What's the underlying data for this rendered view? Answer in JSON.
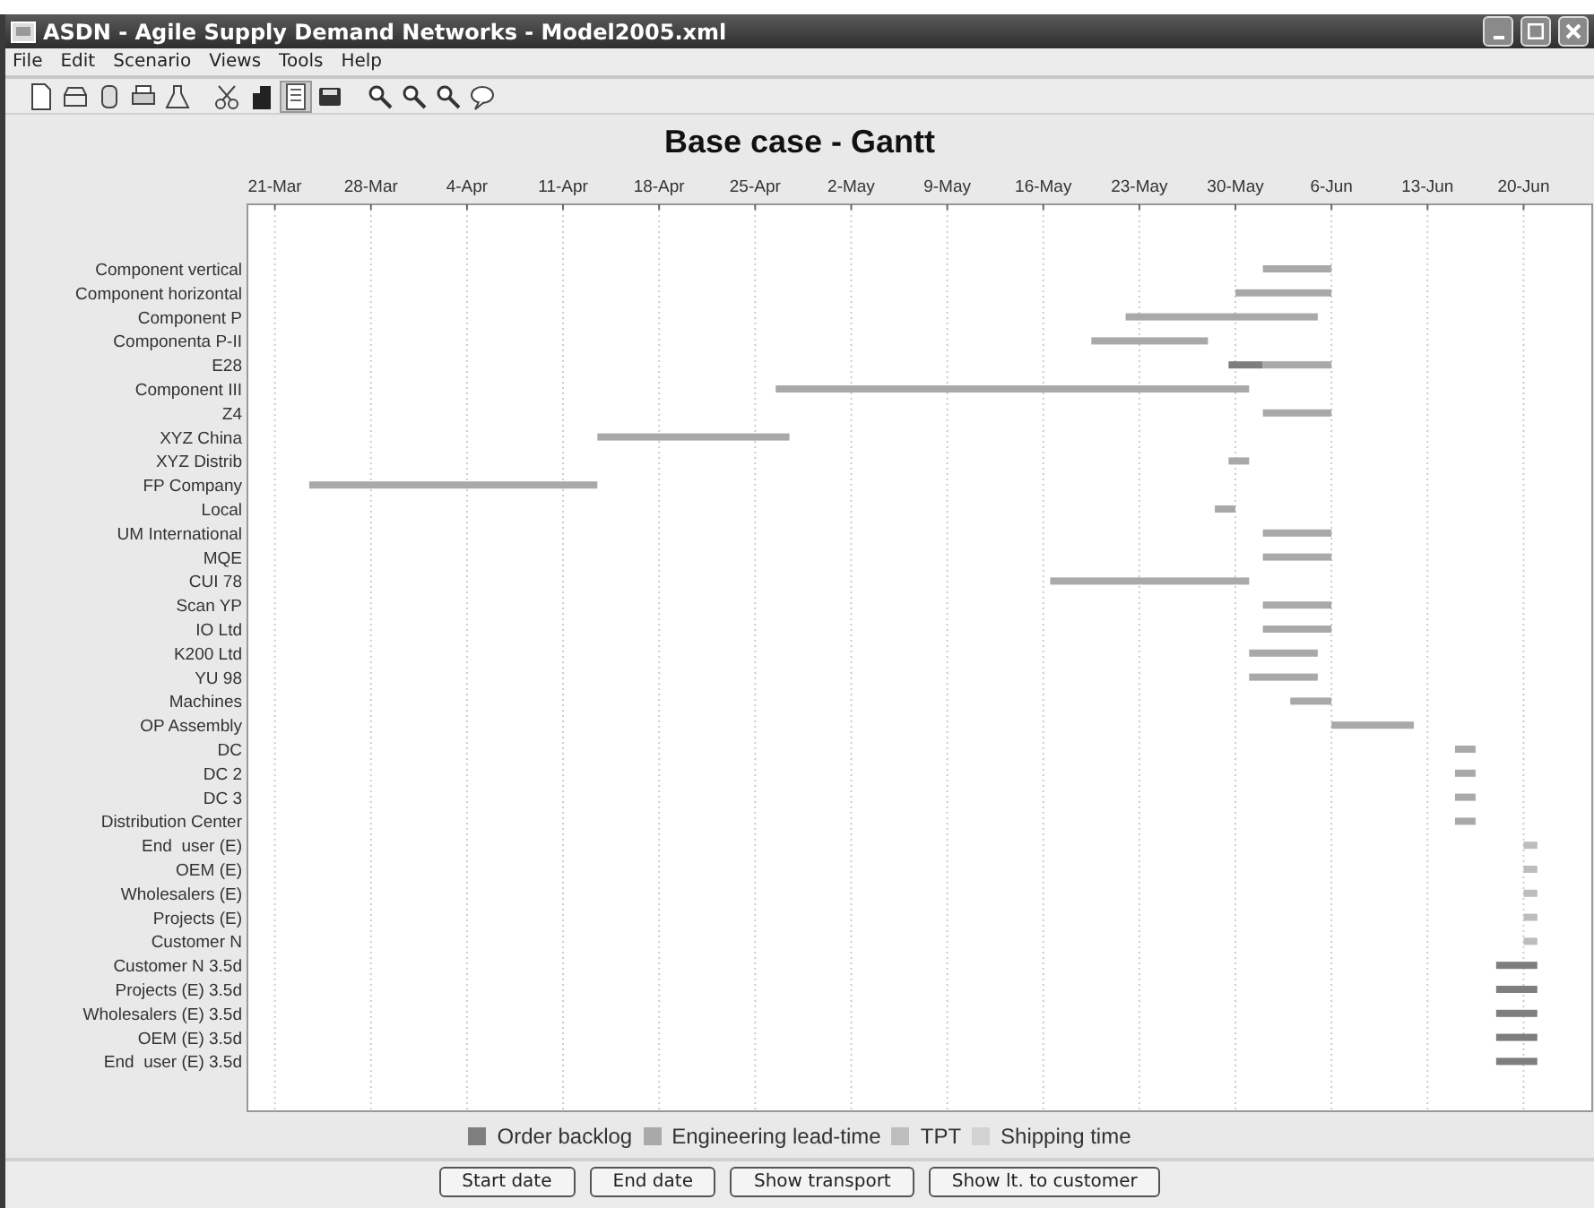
{
  "window": {
    "title": "ASDN - Agile Supply Demand Networks - Model2005.xml"
  },
  "menu": [
    "File",
    "Edit",
    "Scenario",
    "Views",
    "Tools",
    "Help"
  ],
  "toolbar": [
    {
      "kind": "page",
      "selected": false
    },
    {
      "kind": "tray",
      "selected": false
    },
    {
      "kind": "cylinder",
      "selected": false
    },
    {
      "kind": "printer",
      "selected": false
    },
    {
      "kind": "flask",
      "selected": false
    },
    {
      "kind": "scissors",
      "selected": false
    },
    {
      "kind": "building",
      "selected": false
    },
    {
      "kind": "list",
      "selected": true
    },
    {
      "kind": "disk",
      "selected": false
    },
    {
      "kind": "magnifier",
      "selected": false
    },
    {
      "kind": "magnifier",
      "selected": false
    },
    {
      "kind": "magnifier",
      "selected": false
    },
    {
      "kind": "bubble",
      "selected": false
    }
  ],
  "gantt": {
    "title": "Base case - Gantt",
    "date_labels": [
      "21-Mar",
      "28-Mar",
      "4-Apr",
      "11-Apr",
      "18-Apr",
      "25-Apr",
      "2-May",
      "9-May",
      "16-May",
      "23-May",
      "30-May",
      "6-Jun",
      "13-Jun",
      "20-Jun"
    ],
    "rows": [
      "Component vertical",
      "Component horizontal",
      "Component P",
      "Componenta P-II",
      "E28",
      "Component III",
      "Z4",
      "XYZ China",
      "XYZ Distrib",
      "FP Company",
      "Local",
      "UM International",
      "MQE",
      "CUI 78",
      "Scan YP",
      "IO Ltd",
      "K200 Ltd",
      "YU 98",
      "Machines",
      "OP Assembly",
      "DC",
      "DC 2",
      "DC 3",
      "Distribution Center",
      "End  user (E)",
      "OEM (E)",
      "Wholesalers (E)",
      "Projects (E)",
      "Customer N",
      "Customer N 3.5d",
      "Projects (E) 3.5d",
      "Wholesalers (E) 3.5d",
      "OEM (E) 3.5d",
      "End  user (E) 3.5d"
    ],
    "legend": [
      {
        "label": "Order backlog",
        "color": "#7e7e7e"
      },
      {
        "label": "Engineering lead-time",
        "color": "#a9a9a9"
      },
      {
        "label": "TPT",
        "color": "#bdbdbd"
      },
      {
        "label": "Shipping time",
        "color": "#d2d2d2"
      }
    ]
  },
  "buttons": [
    "Start date",
    "End date",
    "Show transport",
    "Show lt. to customer"
  ]
}
